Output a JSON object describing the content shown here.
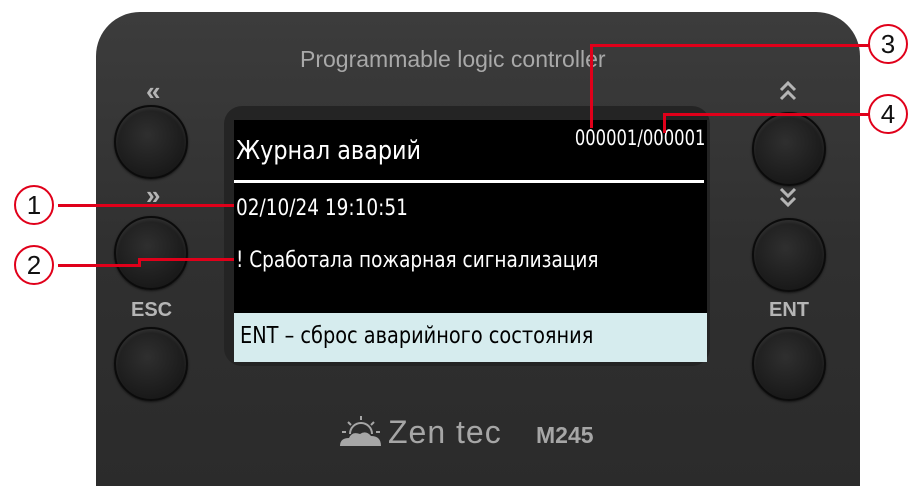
{
  "device": {
    "title": "Programmable logic controller",
    "brand": "Zen tec",
    "model": "M245"
  },
  "buttons": {
    "left": [
      {
        "name": "double-left-button",
        "label": "«"
      },
      {
        "name": "double-right-button",
        "label": "»"
      },
      {
        "name": "esc-button",
        "label": "ESC"
      }
    ],
    "right": [
      {
        "name": "double-up-button",
        "label": "⌃⌃"
      },
      {
        "name": "double-down-button",
        "label": "⌄⌄"
      },
      {
        "name": "ent-button",
        "label": "ENT"
      }
    ]
  },
  "screen": {
    "title": "Журнал аварий",
    "counter": "000001/000001",
    "datetime": "02/10/24 19:10:51",
    "message": "! Сработала пожарная сигнализация",
    "footer": "ENT – сброс аварийного состояния"
  },
  "callouts": [
    "1",
    "2",
    "3",
    "4"
  ],
  "colors": {
    "callout": "#e0001a",
    "lcd_background": "#000000",
    "footer_background": "#d6ecee",
    "device_body": "#333333"
  }
}
